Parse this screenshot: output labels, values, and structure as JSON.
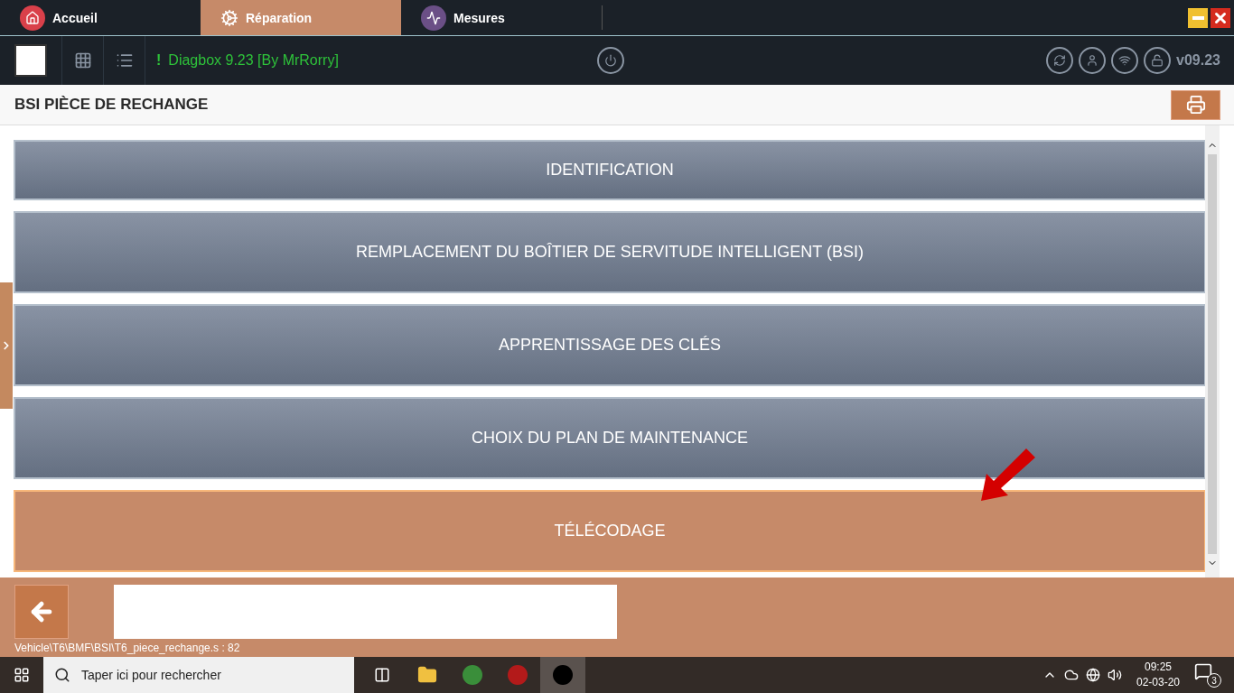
{
  "tabs": [
    {
      "label": "Accueil",
      "kind": "home",
      "selected": false
    },
    {
      "label": "Réparation",
      "kind": "gears",
      "selected": true
    },
    {
      "label": "Mesures",
      "kind": "wave",
      "selected": false
    }
  ],
  "toolbar": {
    "status_mark": "!",
    "status": "Diagbox 9.23 [By MrRorry]",
    "version": "v09.23"
  },
  "page_title": "BSI PIÈCE DE RECHANGE",
  "menu_items": [
    {
      "label": "IDENTIFICATION",
      "selected": false
    },
    {
      "label": "REMPLACEMENT DU BOÎTIER DE SERVITUDE INTELLIGENT (BSI)",
      "selected": false
    },
    {
      "label": "APPRENTISSAGE DES CLÉS",
      "selected": false
    },
    {
      "label": "CHOIX DU PLAN DE MAINTENANCE",
      "selected": false
    },
    {
      "label": "TÉLÉCODAGE",
      "selected": true
    }
  ],
  "footer": {
    "path": "Vehicle\\T6\\BMF\\BSI\\T6_piece_rechange.s : 82"
  },
  "taskbar": {
    "search_placeholder": "Taper ici pour rechercher",
    "time": "09:25",
    "date": "02-03-20",
    "notifications": "3"
  }
}
